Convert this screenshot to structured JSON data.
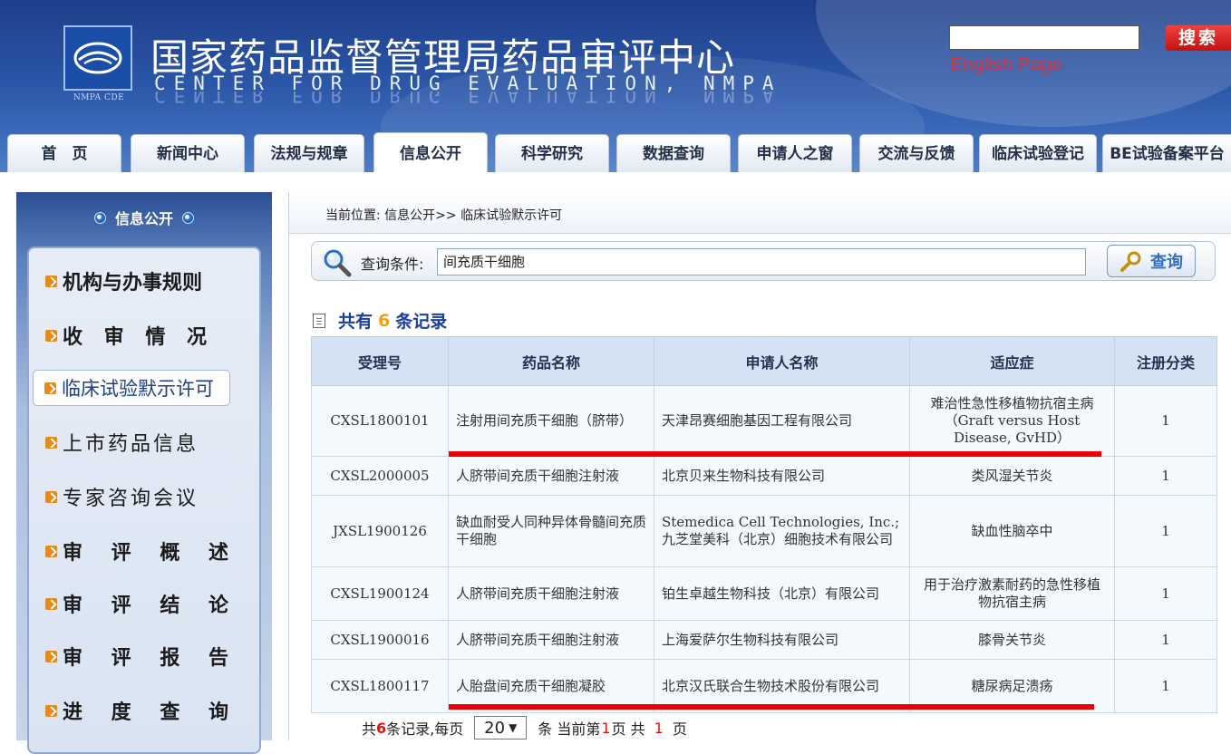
{
  "header": {
    "title": "国家药品监督管理局药品审评中心",
    "subtitle": "CENTER FOR DRUG EVALUATION, NMPA",
    "logo_text": "NMPA CDE",
    "search_button": "搜索",
    "search_value": "",
    "english_link": "English Page"
  },
  "nav": {
    "tabs": [
      {
        "label": "首　页"
      },
      {
        "label": "新闻中心"
      },
      {
        "label": "法规与规章"
      },
      {
        "label": "信息公开"
      },
      {
        "label": "科学研究"
      },
      {
        "label": "数据查询"
      },
      {
        "label": "申请人之窗"
      },
      {
        "label": "交流与反馈"
      },
      {
        "label": "临床试验登记"
      },
      {
        "label": "BE试验备案平台"
      }
    ],
    "active": "信息公开"
  },
  "sidebar": {
    "title": "信息公开",
    "items": [
      {
        "label": "机构与办事规则"
      },
      {
        "label": "收 审 情 况"
      },
      {
        "label": "临床试验默示许可"
      },
      {
        "label": "上市药品信息"
      },
      {
        "label": "专家咨询会议"
      },
      {
        "label": "审 评 概 述"
      },
      {
        "label": "审 评 结 论"
      },
      {
        "label": "审 评 报 告"
      },
      {
        "label": "进 度 查 询"
      }
    ]
  },
  "breadcrumb": "当前位置: 信息公开>> 临床试验默示许可",
  "query": {
    "label": "查询条件:",
    "value": "间充质干细胞",
    "button": "查询"
  },
  "summary": {
    "prefix": "共有",
    "count": "6",
    "suffix": "条记录"
  },
  "table": {
    "headers": [
      "受理号",
      "药品名称",
      "申请人名称",
      "适应症",
      "注册分类"
    ],
    "rows": [
      [
        "CXSL1800101",
        "注射用间充质干细胞（脐带）",
        "天津昂赛细胞基因工程有限公司",
        "难治性急性移植物抗宿主病（Graft versus Host Disease, GvHD）",
        "1"
      ],
      [
        "CXSL2000005",
        "人脐带间充质干细胞注射液",
        "北京贝来生物科技有限公司",
        "类风湿关节炎",
        "1"
      ],
      [
        "JXSL1900126",
        "缺血耐受人同种异体骨髓间充质干细胞",
        "Stemedica Cell Technologies, Inc.;九芝堂美科（北京）细胞技术有限公司",
        "缺血性脑卒中",
        "1"
      ],
      [
        "CXSL1900124",
        "人脐带间充质干细胞注射液",
        "铂生卓越生物科技（北京）有限公司",
        "用于治疗激素耐药的急性移植物抗宿主病",
        "1"
      ],
      [
        "CXSL1900016",
        "人脐带间充质干细胞注射液",
        "上海爱萨尔生物科技有限公司",
        "膝骨关节炎",
        "1"
      ],
      [
        "CXSL1800117",
        "人胎盘间充质干细胞凝胶",
        "北京汉氏联合生物技术股份有限公司",
        "糖尿病足溃疡",
        "1"
      ]
    ]
  },
  "pager": {
    "p1": "共",
    "total": "6",
    "p2": "条记录,每页",
    "page_size": "20",
    "p3": "条 当前第",
    "current": "1",
    "p4": "页 共",
    "pages": "1",
    "p5": "页"
  },
  "colors": {
    "accent": "#1a3f9c",
    "highlight": "#ee0000",
    "header_bg": "#2a54a5"
  }
}
